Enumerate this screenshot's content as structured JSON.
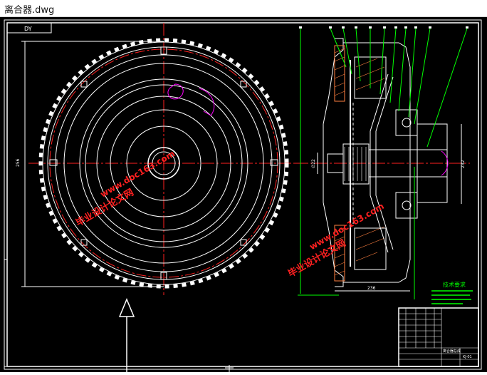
{
  "window": {
    "title": "离合器.dwg"
  },
  "drawing": {
    "block_label": "DY",
    "dim_front_width": "256",
    "dim_side_height": "232",
    "dim_side_width": "236",
    "dim_shaft_dia": "∅22",
    "tech_req_title": "技术要求",
    "watermark_line1": "毕业设计论文网",
    "watermark_line2": "www.doc163.com",
    "tb_drawing_name": "离合器总成",
    "tb_code": "KJ-01",
    "colors": {
      "background": "#000000",
      "frame": "#ffffff",
      "part": "#ffffff",
      "center_line": "#ff2020",
      "leader": "#00ff00",
      "section": "#ff8040",
      "annotation": "#ff00ff",
      "tech_text": "#00ff00",
      "watermark": "#ff2020"
    }
  }
}
